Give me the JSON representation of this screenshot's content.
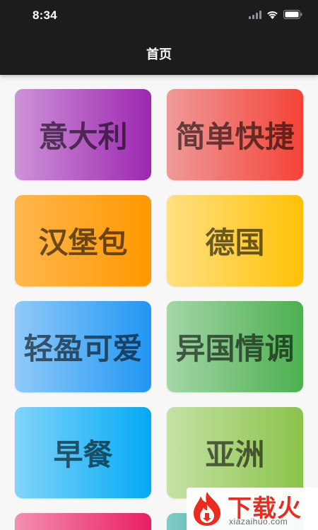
{
  "status_bar": {
    "time": "8:34",
    "icons": [
      "signal-icon",
      "wifi-icon",
      "battery-icon"
    ]
  },
  "nav": {
    "title": "首页"
  },
  "categories": [
    {
      "label": "意大利",
      "gradient": [
        "#ce93d8",
        "#9c27b0"
      ]
    },
    {
      "label": "简单快捷",
      "gradient": [
        "#ef9a9a",
        "#f44336"
      ]
    },
    {
      "label": "汉堡包",
      "gradient": [
        "#ffb74d",
        "#ff9800"
      ]
    },
    {
      "label": "德国",
      "gradient": [
        "#ffe082",
        "#ffc107"
      ]
    },
    {
      "label": "轻盈可爱",
      "gradient": [
        "#90caf9",
        "#2196f3"
      ]
    },
    {
      "label": "异国情调",
      "gradient": [
        "#a5d6a7",
        "#4caf50"
      ]
    },
    {
      "label": "早餐",
      "gradient": [
        "#81d4fa",
        "#03a9f4"
      ]
    },
    {
      "label": "亚洲",
      "gradient": [
        "#c5e1a5",
        "#8bc34a"
      ]
    },
    {
      "label": "",
      "gradient": [
        "#f48fb1",
        "#e91e63"
      ]
    },
    {
      "label": "",
      "gradient": [
        "#80cbc4",
        "#009688"
      ]
    }
  ],
  "watermark": {
    "title": "下载火",
    "url": "xiazaihuo.com",
    "brand_color": "#ea2b1f"
  }
}
